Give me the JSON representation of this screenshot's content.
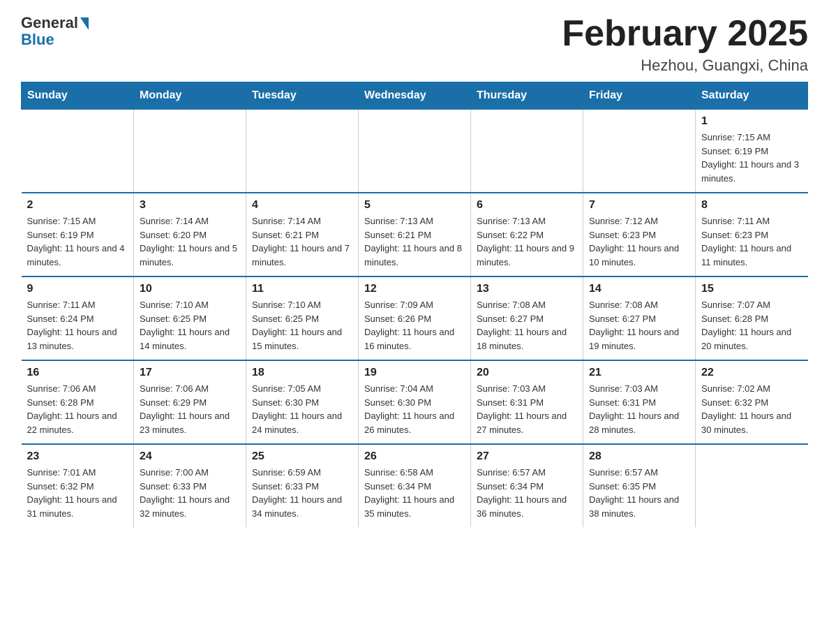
{
  "header": {
    "logo": {
      "general_text": "General",
      "blue_text": "Blue"
    },
    "title": "February 2025",
    "location": "Hezhou, Guangxi, China"
  },
  "calendar": {
    "days_of_week": [
      "Sunday",
      "Monday",
      "Tuesday",
      "Wednesday",
      "Thursday",
      "Friday",
      "Saturday"
    ],
    "weeks": [
      {
        "days": [
          {
            "number": "",
            "info": ""
          },
          {
            "number": "",
            "info": ""
          },
          {
            "number": "",
            "info": ""
          },
          {
            "number": "",
            "info": ""
          },
          {
            "number": "",
            "info": ""
          },
          {
            "number": "",
            "info": ""
          },
          {
            "number": "1",
            "info": "Sunrise: 7:15 AM\nSunset: 6:19 PM\nDaylight: 11 hours and 3 minutes."
          }
        ]
      },
      {
        "days": [
          {
            "number": "2",
            "info": "Sunrise: 7:15 AM\nSunset: 6:19 PM\nDaylight: 11 hours and 4 minutes."
          },
          {
            "number": "3",
            "info": "Sunrise: 7:14 AM\nSunset: 6:20 PM\nDaylight: 11 hours and 5 minutes."
          },
          {
            "number": "4",
            "info": "Sunrise: 7:14 AM\nSunset: 6:21 PM\nDaylight: 11 hours and 7 minutes."
          },
          {
            "number": "5",
            "info": "Sunrise: 7:13 AM\nSunset: 6:21 PM\nDaylight: 11 hours and 8 minutes."
          },
          {
            "number": "6",
            "info": "Sunrise: 7:13 AM\nSunset: 6:22 PM\nDaylight: 11 hours and 9 minutes."
          },
          {
            "number": "7",
            "info": "Sunrise: 7:12 AM\nSunset: 6:23 PM\nDaylight: 11 hours and 10 minutes."
          },
          {
            "number": "8",
            "info": "Sunrise: 7:11 AM\nSunset: 6:23 PM\nDaylight: 11 hours and 11 minutes."
          }
        ]
      },
      {
        "days": [
          {
            "number": "9",
            "info": "Sunrise: 7:11 AM\nSunset: 6:24 PM\nDaylight: 11 hours and 13 minutes."
          },
          {
            "number": "10",
            "info": "Sunrise: 7:10 AM\nSunset: 6:25 PM\nDaylight: 11 hours and 14 minutes."
          },
          {
            "number": "11",
            "info": "Sunrise: 7:10 AM\nSunset: 6:25 PM\nDaylight: 11 hours and 15 minutes."
          },
          {
            "number": "12",
            "info": "Sunrise: 7:09 AM\nSunset: 6:26 PM\nDaylight: 11 hours and 16 minutes."
          },
          {
            "number": "13",
            "info": "Sunrise: 7:08 AM\nSunset: 6:27 PM\nDaylight: 11 hours and 18 minutes."
          },
          {
            "number": "14",
            "info": "Sunrise: 7:08 AM\nSunset: 6:27 PM\nDaylight: 11 hours and 19 minutes."
          },
          {
            "number": "15",
            "info": "Sunrise: 7:07 AM\nSunset: 6:28 PM\nDaylight: 11 hours and 20 minutes."
          }
        ]
      },
      {
        "days": [
          {
            "number": "16",
            "info": "Sunrise: 7:06 AM\nSunset: 6:28 PM\nDaylight: 11 hours and 22 minutes."
          },
          {
            "number": "17",
            "info": "Sunrise: 7:06 AM\nSunset: 6:29 PM\nDaylight: 11 hours and 23 minutes."
          },
          {
            "number": "18",
            "info": "Sunrise: 7:05 AM\nSunset: 6:30 PM\nDaylight: 11 hours and 24 minutes."
          },
          {
            "number": "19",
            "info": "Sunrise: 7:04 AM\nSunset: 6:30 PM\nDaylight: 11 hours and 26 minutes."
          },
          {
            "number": "20",
            "info": "Sunrise: 7:03 AM\nSunset: 6:31 PM\nDaylight: 11 hours and 27 minutes."
          },
          {
            "number": "21",
            "info": "Sunrise: 7:03 AM\nSunset: 6:31 PM\nDaylight: 11 hours and 28 minutes."
          },
          {
            "number": "22",
            "info": "Sunrise: 7:02 AM\nSunset: 6:32 PM\nDaylight: 11 hours and 30 minutes."
          }
        ]
      },
      {
        "days": [
          {
            "number": "23",
            "info": "Sunrise: 7:01 AM\nSunset: 6:32 PM\nDaylight: 11 hours and 31 minutes."
          },
          {
            "number": "24",
            "info": "Sunrise: 7:00 AM\nSunset: 6:33 PM\nDaylight: 11 hours and 32 minutes."
          },
          {
            "number": "25",
            "info": "Sunrise: 6:59 AM\nSunset: 6:33 PM\nDaylight: 11 hours and 34 minutes."
          },
          {
            "number": "26",
            "info": "Sunrise: 6:58 AM\nSunset: 6:34 PM\nDaylight: 11 hours and 35 minutes."
          },
          {
            "number": "27",
            "info": "Sunrise: 6:57 AM\nSunset: 6:34 PM\nDaylight: 11 hours and 36 minutes."
          },
          {
            "number": "28",
            "info": "Sunrise: 6:57 AM\nSunset: 6:35 PM\nDaylight: 11 hours and 38 minutes."
          },
          {
            "number": "",
            "info": ""
          }
        ]
      }
    ]
  },
  "colors": {
    "header_bg": "#1a6fa8",
    "header_text": "#ffffff",
    "border": "#1a6fa8"
  }
}
